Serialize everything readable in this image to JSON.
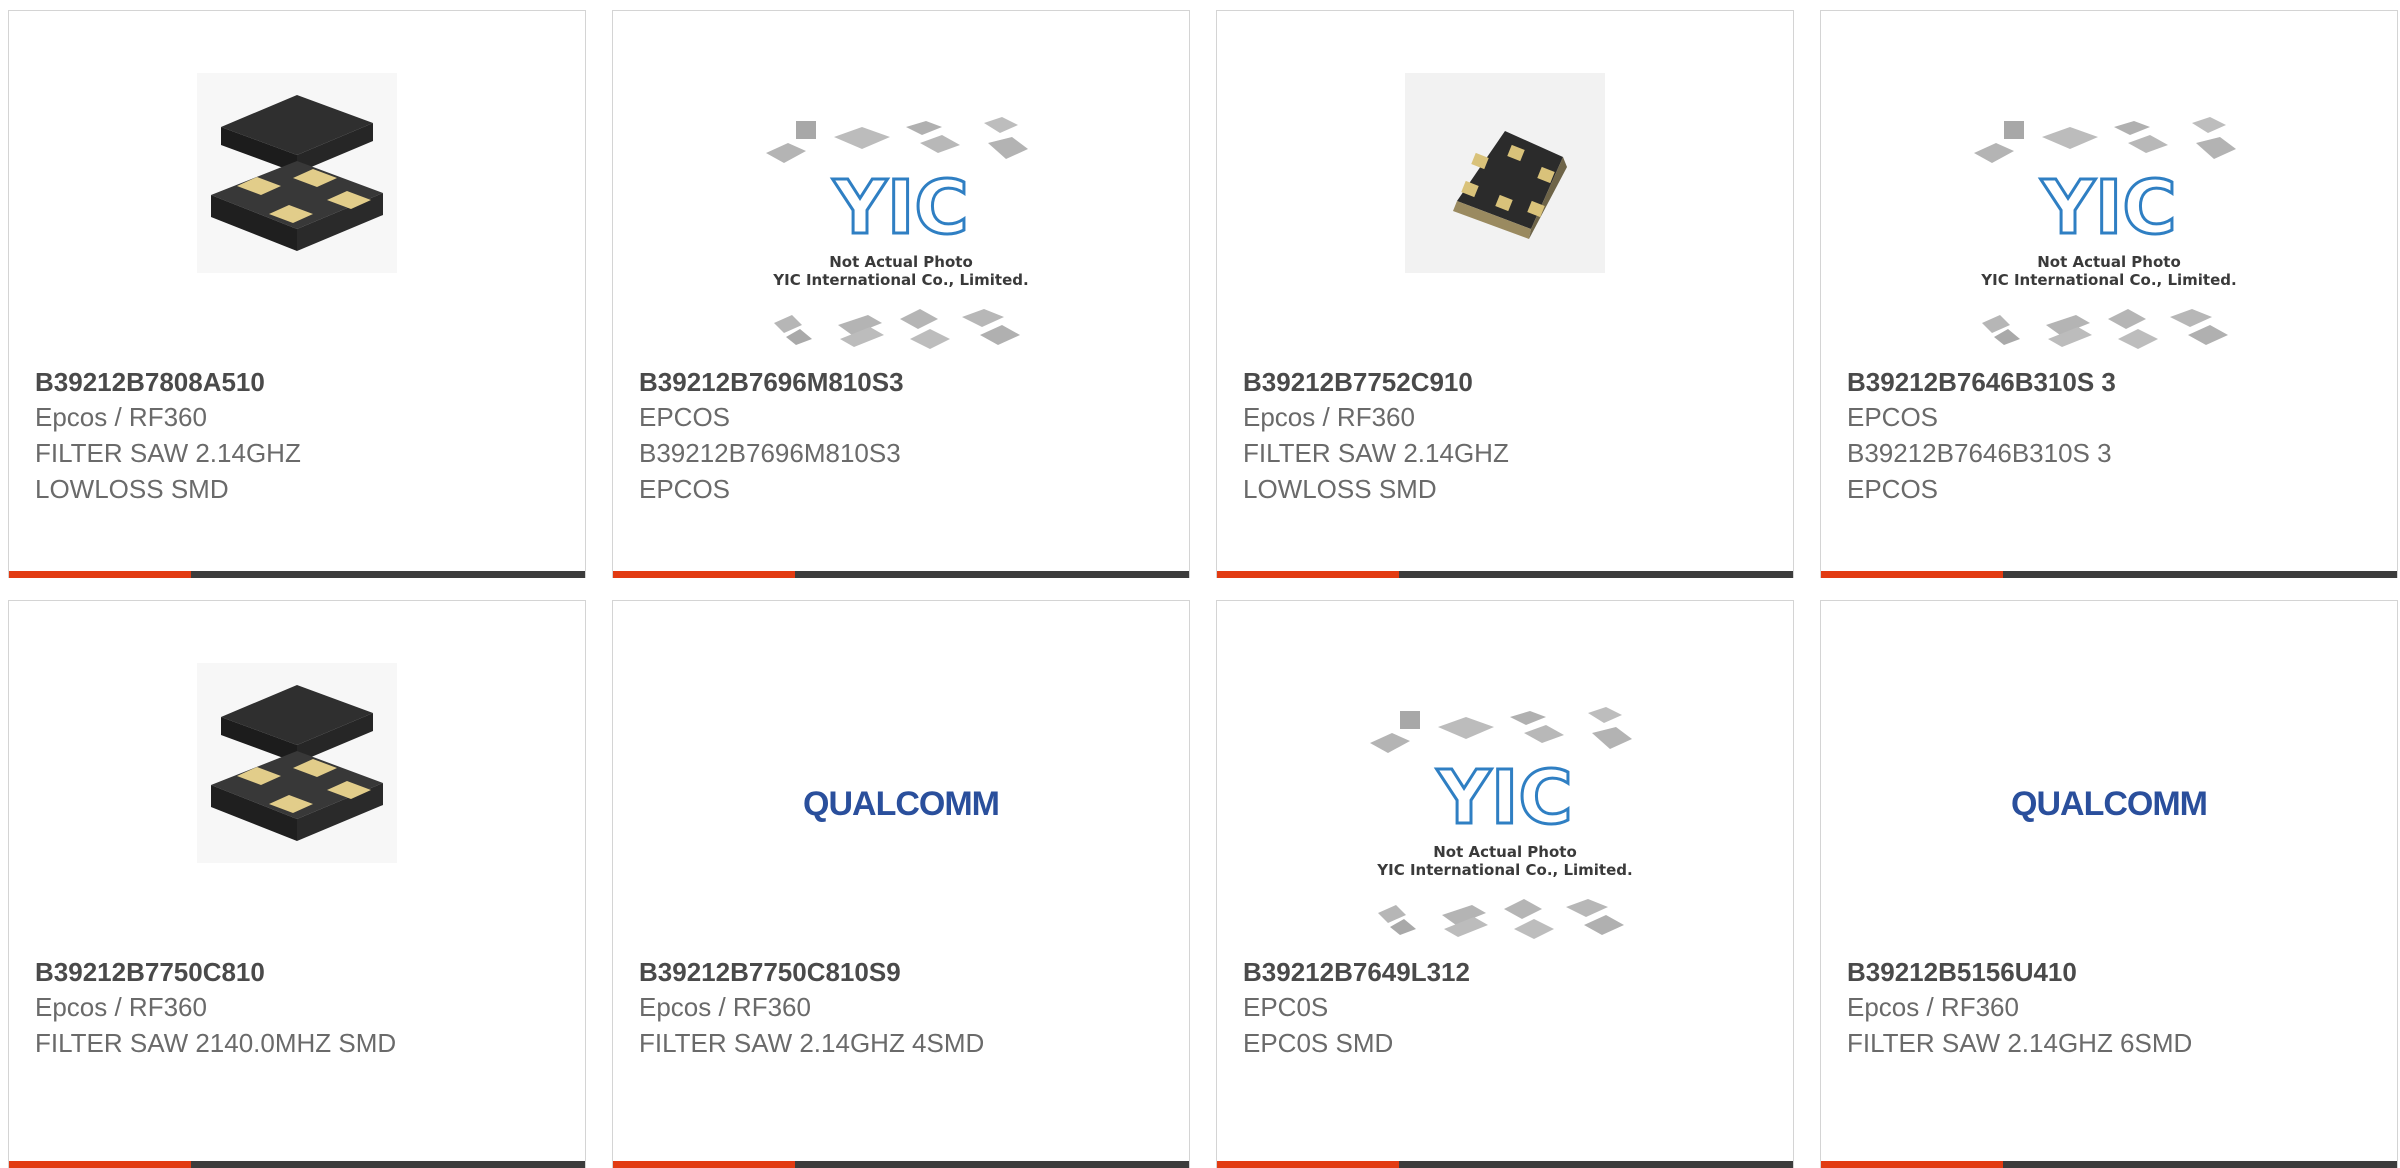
{
  "colors": {
    "accent": "#e23b12",
    "bar": "#3c3c3c",
    "border": "#d4d4d4",
    "part_number": "#4a4a4a",
    "text": "#6a6a6a",
    "qualcomm_blue": "#2a4f9c",
    "yic_blue": "#2f7fc3"
  },
  "yic_placeholder": {
    "line1": "Not Actual Photo",
    "line2": "YIC International Co., Limited."
  },
  "qualcomm_logo": {
    "text": "QUALCOMM"
  },
  "products": [
    {
      "part_number": "B39212B7808A510",
      "manufacturer": "Epcos / RF360",
      "description": "FILTER SAW 2.14GHZ LOWLOSS SMD",
      "image_icon": "saw-filter-4pad-icon"
    },
    {
      "part_number": "B39212B7696M810S3",
      "manufacturer": "EPCOS",
      "description": "B39212B7696M810S3 EPCOS",
      "image_icon": "yic-placeholder-icon"
    },
    {
      "part_number": "B39212B7752C910",
      "manufacturer": "Epcos / RF360",
      "description": "FILTER SAW 2.14GHZ LOWLOSS SMD",
      "image_icon": "saw-filter-6pad-icon"
    },
    {
      "part_number": "B39212B7646B310S 3",
      "manufacturer": "EPCOS",
      "description": "B39212B7646B310S 3 EPCOS",
      "image_icon": "yic-placeholder-icon"
    },
    {
      "part_number": "B39212B7750C810",
      "manufacturer": "Epcos / RF360",
      "description": "FILTER SAW 2140.0MHZ SMD",
      "image_icon": "saw-filter-4pad-icon"
    },
    {
      "part_number": "B39212B7750C810S9",
      "manufacturer": "Epcos / RF360",
      "description": "FILTER SAW 2.14GHZ 4SMD",
      "image_icon": "qualcomm-logo-icon"
    },
    {
      "part_number": "B39212B7649L312",
      "manufacturer": "EPC0S",
      "description": "EPC0S SMD",
      "image_icon": "yic-placeholder-icon"
    },
    {
      "part_number": "B39212B5156U410",
      "manufacturer": "Epcos / RF360",
      "description": "FILTER SAW 2.14GHZ 6SMD",
      "image_icon": "qualcomm-logo-icon"
    }
  ]
}
